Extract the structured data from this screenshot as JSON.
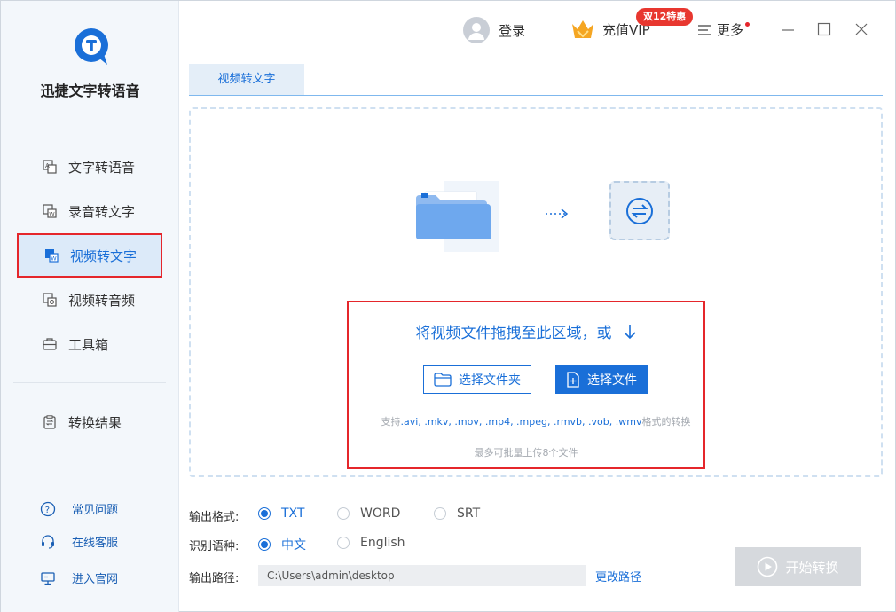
{
  "app": {
    "name": "迅捷文字转语音"
  },
  "sidebar": {
    "items": [
      {
        "label": "文字转语音",
        "icon": "text-to-speech-icon"
      },
      {
        "label": "录音转文字",
        "icon": "recording-to-text-icon"
      },
      {
        "label": "视频转文字",
        "icon": "video-to-text-icon",
        "active": true
      },
      {
        "label": "视频转音频",
        "icon": "video-to-audio-icon"
      },
      {
        "label": "工具箱",
        "icon": "toolbox-icon"
      },
      {
        "label": "转换结果",
        "icon": "results-icon"
      }
    ],
    "footer": [
      {
        "label": "常见问题",
        "icon": "question-icon"
      },
      {
        "label": "在线客服",
        "icon": "headset-icon"
      },
      {
        "label": "进入官网",
        "icon": "monitor-icon"
      }
    ]
  },
  "header": {
    "login_label": "登录",
    "vip_label": "充值VIP",
    "promo_badge": "双12特惠",
    "more_label": "更多"
  },
  "tab": {
    "label": "视频转文字"
  },
  "dropzone": {
    "prompt": "将视频文件拖拽至此区域，或",
    "choose_folder": "选择文件夹",
    "choose_file": "选择文件",
    "formats_prefix": "支持",
    "formats": ".avi, .mkv, .mov, .mp4, .mpeg, .rmvb, .vob, .wmv",
    "formats_suffix": "格式的转换",
    "batch_note": "最多可批量上传8个文件"
  },
  "options": {
    "output_format_label": "输出格式:",
    "output_formats": [
      {
        "label": "TXT",
        "checked": true
      },
      {
        "label": "WORD",
        "checked": false
      },
      {
        "label": "SRT",
        "checked": false
      }
    ],
    "language_label": "识别语种:",
    "languages": [
      {
        "label": "中文",
        "checked": true
      },
      {
        "label": "English",
        "checked": false
      }
    ],
    "path_label": "输出路径:",
    "path_value": "C:\\Users\\admin\\desktop",
    "change_path": "更改路径",
    "start_button": "开始转换"
  },
  "colors": {
    "accent": "#1a6fd8",
    "highlight_border": "#e5262b",
    "promo": "#e8372f",
    "sidebar_bg": "#f3f7fb"
  }
}
